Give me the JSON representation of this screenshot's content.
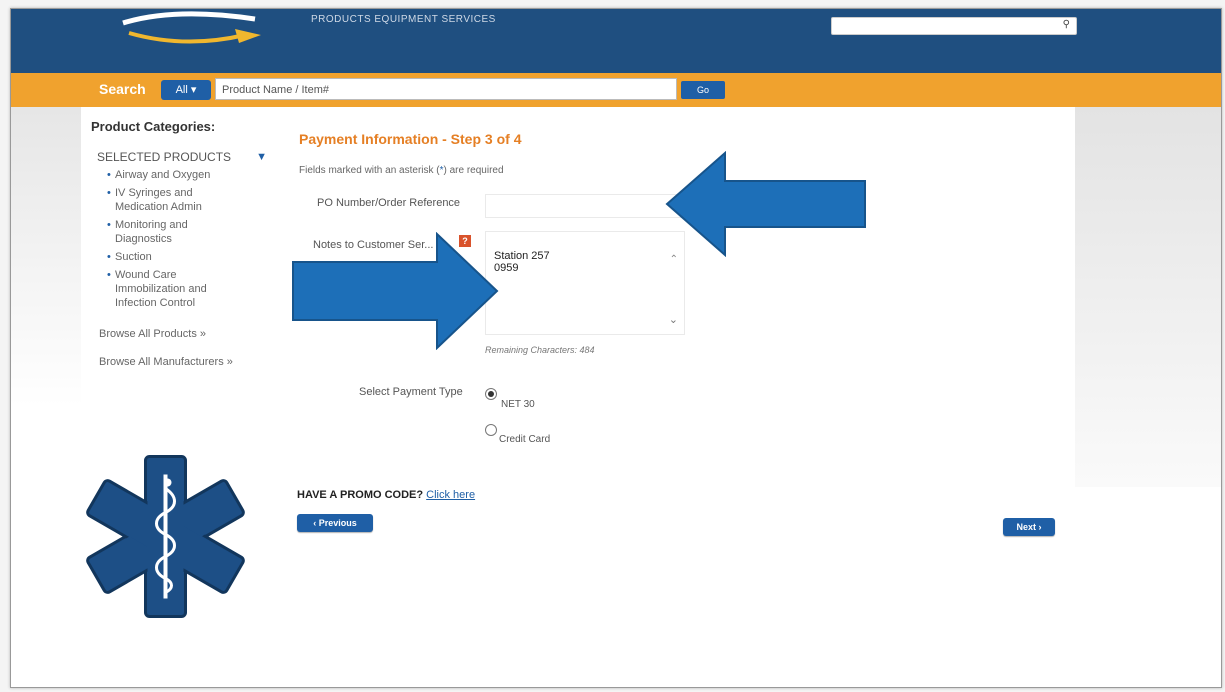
{
  "header": {
    "nav_text": "PRODUCTS  EQUIPMENT  SERVICES",
    "search_icon": "search-icon"
  },
  "search_bar": {
    "label": "Search",
    "scope": "All ▾",
    "placeholder": "Product Name / Item#",
    "go_label": "Go"
  },
  "sidebar": {
    "title": "Product Categories:",
    "selected_header": "SELECTED PRODUCTS",
    "items": [
      "Airway and Oxygen",
      "IV Syringes and Medication Admin",
      "Monitoring and Diagnostics",
      "Suction",
      "Wound Care Immobilization and Infection Control"
    ],
    "browse_products": "Browse All Products »",
    "browse_manufacturers": "Browse All Manufacturers »"
  },
  "form": {
    "title": "Payment Information - Step 3 of 4",
    "required_note_pre": "Fields marked with an asterisk (",
    "required_note_ast": "*",
    "required_note_post": ") are required",
    "po_label": "PO Number/Order Reference",
    "po_value": "",
    "notes_label": "Notes to Customer Ser...",
    "notes_value": "Station 257\n0959",
    "remaining": "Remaining Characters: 484",
    "payment_label": "Select Payment Type",
    "payment_options": [
      {
        "label": "NET 30",
        "checked": true
      },
      {
        "label": "Credit Card",
        "checked": false
      }
    ]
  },
  "promo": {
    "text": "HAVE A PROMO CODE?",
    "link": "Click here"
  },
  "buttons": {
    "previous": "‹ Previous",
    "next": "Next ›"
  },
  "colors": {
    "header_blue": "#1f4f80",
    "search_orange": "#f0a22e",
    "accent_blue": "#1f5fa6",
    "title_orange": "#e57f24",
    "arrow_blue": "#1d6fb8",
    "star_of_life_blue": "#1d4f86"
  }
}
